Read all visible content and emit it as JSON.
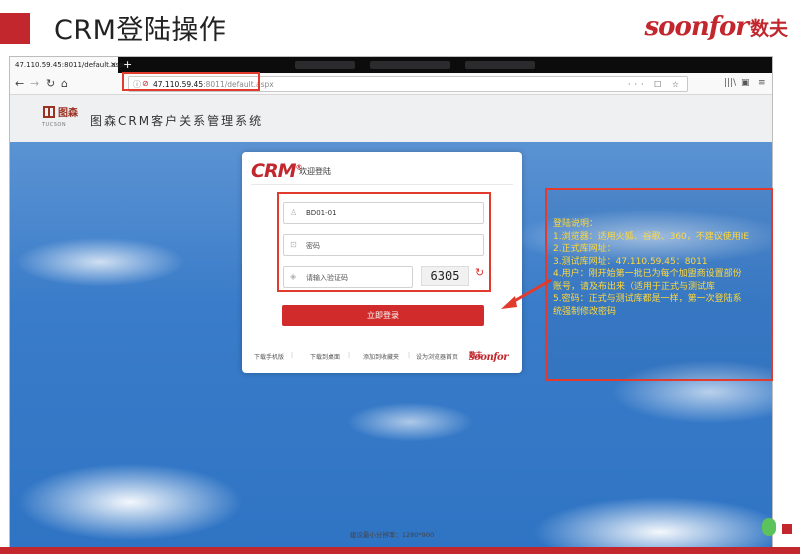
{
  "slide": {
    "title": "CRM登陆操作",
    "brand_word": "soonfor",
    "brand_cn": "数夫"
  },
  "browser": {
    "tab_title": "47.110.59.45:8011/default.aspx",
    "tab_close": "×",
    "new_tab": "+",
    "url_host": "47.110.59.45",
    "url_path": ":8011/default.aspx",
    "url_actions": "··· ☐ ☆",
    "nav": {
      "back": "←",
      "forward": "→",
      "reload": "↻",
      "home": "⌂"
    },
    "toolbar_right": {
      "library": "|||\\",
      "sidebar": "▣",
      "menu": "≡"
    }
  },
  "site": {
    "logo_cn": "图森",
    "logo_en": "TUCSON",
    "title": "图森CRM客户关系管理系统",
    "resolution_note": "建议最小分辨率：1280*900"
  },
  "login": {
    "logo": "CRM",
    "logo_mark": "®",
    "welcome": "欢迎登陆",
    "username_value": "BD01-01",
    "password_placeholder": "密码",
    "captcha_placeholder": "请输入验证码",
    "captcha_code": "6305",
    "login_button": "立即登录",
    "footer_links": [
      "下载手机版",
      "下载到桌面",
      "添加到收藏夹",
      "设为浏览器首页"
    ],
    "footer_brand": "soonfor",
    "footer_brand_cn": "数夫"
  },
  "annotation": {
    "lines": [
      "登陆说明：",
      "1.浏览器：适用火狐、谷歌、360，不建议使用IE",
      "2.正式库网址：",
      "3.测试库网址：47.110.59.45：8011",
      "4.用户：刚开始第一批已为每个加盟商设置部份",
      "账号，请及布出来（适用于正式与测试库",
      "5.密码：正式与测试库都是一样，第一次登陆系",
      "统强制修改密码"
    ]
  },
  "colors": {
    "accent_red": "#c2272d",
    "annotation_text": "#ffd83a",
    "login_button": "#d22b2b"
  }
}
